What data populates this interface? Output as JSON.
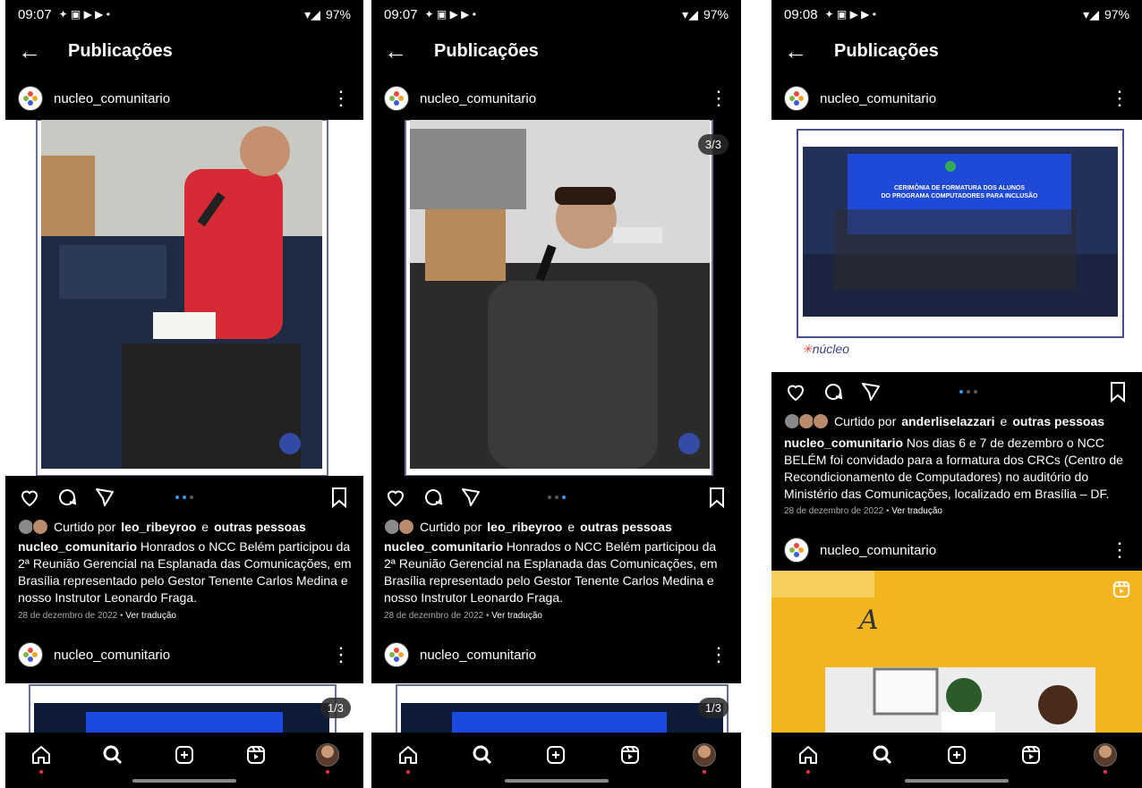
{
  "screens": [
    {
      "status": {
        "time": "09:07",
        "battery": "97%"
      },
      "header": {
        "title": "Publicações"
      },
      "post1": {
        "username": "nucleo_comunitario",
        "counter": "",
        "liked_prefix": "Curtido por",
        "liked_user": "leo_ribeyroo",
        "liked_suffix": "e",
        "liked_others": "outras pessoas",
        "caption_user": "nucleo_comunitario",
        "caption_text": "Honrados o NCC Belém participou da 2ª Reunião Gerencial na Esplanada das Comunicações, em Brasília representado pelo Gestor Tenente Carlos Medina e nosso Instrutor Leonardo Fraga.",
        "date": "28 de dezembro de 2022",
        "translate": "Ver tradução",
        "active_dot": 1
      },
      "post2": {
        "username": "nucleo_comunitario",
        "counter": "1/3"
      }
    },
    {
      "status": {
        "time": "09:07",
        "battery": "97%"
      },
      "header": {
        "title": "Publicações"
      },
      "post1": {
        "username": "nucleo_comunitario",
        "counter": "3/3",
        "liked_prefix": "Curtido por",
        "liked_user": "leo_ribeyroo",
        "liked_suffix": "e",
        "liked_others": "outras pessoas",
        "caption_user": "nucleo_comunitario",
        "caption_text": "Honrados o NCC Belém participou da 2ª Reunião Gerencial na Esplanada das Comunicações, em Brasília representado pelo Gestor Tenente Carlos Medina e nosso Instrutor Leonardo Fraga.",
        "date": "28 de dezembro de 2022",
        "translate": "Ver tradução",
        "active_dot": 2
      },
      "post2": {
        "username": "nucleo_comunitario",
        "counter": "1/3"
      }
    },
    {
      "status": {
        "time": "09:08",
        "battery": "97%"
      },
      "header": {
        "title": "Publicações"
      },
      "post1": {
        "username": "nucleo_comunitario",
        "counter": "",
        "banner_line1": "CERIMÔNIA DE FORMATURA DOS ALUNOS",
        "banner_line2": "DO PROGRAMA COMPUTADORES PARA INCLUSÃO",
        "logo_text": "núcleo",
        "liked_prefix": "Curtido por",
        "liked_user": "anderliselazzari",
        "liked_suffix": "e",
        "liked_others": "outras pessoas",
        "caption_user": "nucleo_comunitario",
        "caption_text": "Nos dias 6 e 7 de dezembro o NCC BELÉM foi convidado para a formatura dos CRCs (Centro de Recondicionamento de Computadores) no auditório do Ministério das Comunicações, localizado em Brasília – DF.",
        "date": "28 de dezembro de 2022",
        "translate": "Ver tradução",
        "active_dot": 0
      },
      "post2": {
        "username": "nucleo_comunitario",
        "board_letter": "A"
      }
    }
  ],
  "icons": {
    "back": "arrow-left-icon",
    "more": "more-vertical-icon",
    "like": "heart-icon",
    "comment": "comment-icon",
    "share": "send-icon",
    "save": "bookmark-icon",
    "nav": [
      "home-icon",
      "search-icon",
      "add-icon",
      "reels-icon",
      "profile-icon"
    ]
  }
}
